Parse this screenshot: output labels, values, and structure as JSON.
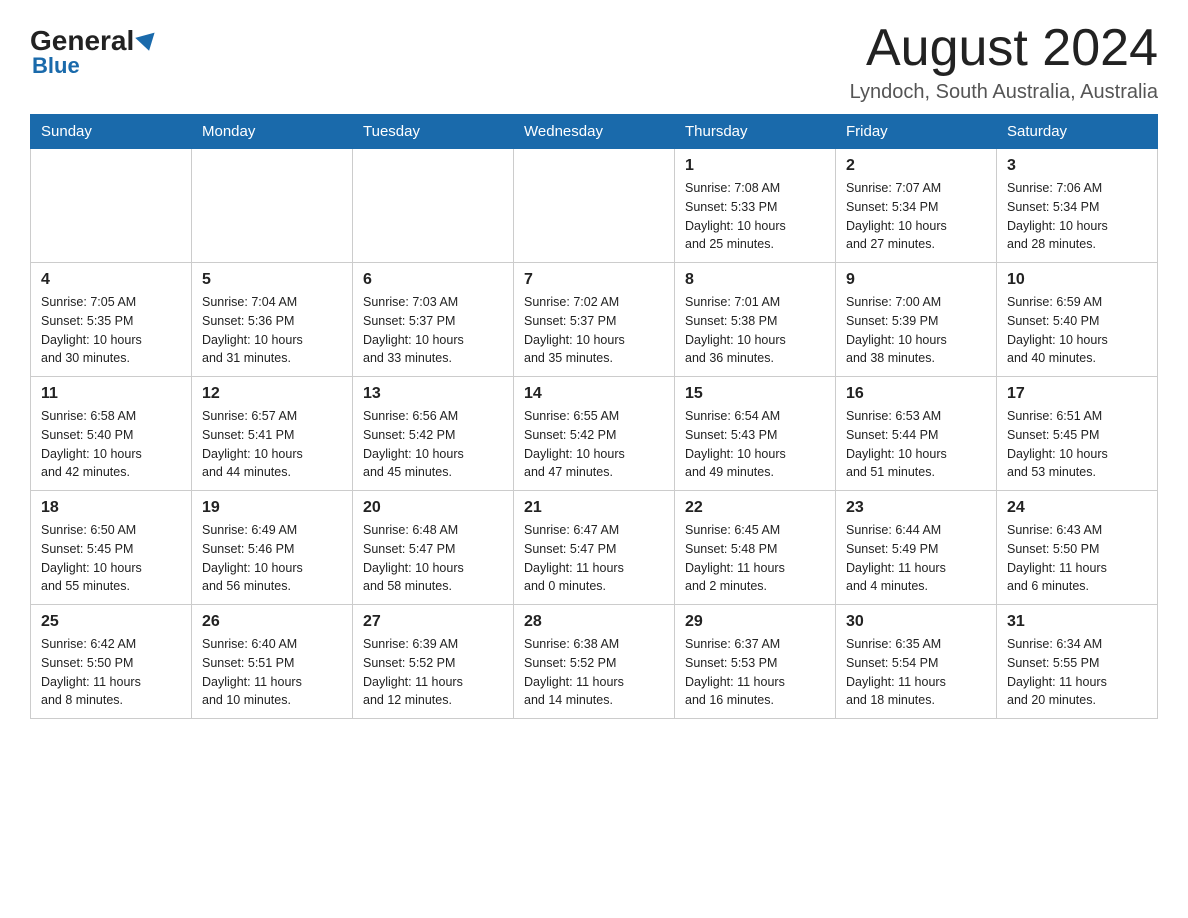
{
  "header": {
    "logo_general": "General",
    "logo_blue": "Blue",
    "month_title": "August 2024",
    "location": "Lyndoch, South Australia, Australia"
  },
  "weekdays": [
    "Sunday",
    "Monday",
    "Tuesday",
    "Wednesday",
    "Thursday",
    "Friday",
    "Saturday"
  ],
  "weeks": [
    {
      "days": [
        {
          "num": "",
          "info": ""
        },
        {
          "num": "",
          "info": ""
        },
        {
          "num": "",
          "info": ""
        },
        {
          "num": "",
          "info": ""
        },
        {
          "num": "1",
          "info": "Sunrise: 7:08 AM\nSunset: 5:33 PM\nDaylight: 10 hours\nand 25 minutes."
        },
        {
          "num": "2",
          "info": "Sunrise: 7:07 AM\nSunset: 5:34 PM\nDaylight: 10 hours\nand 27 minutes."
        },
        {
          "num": "3",
          "info": "Sunrise: 7:06 AM\nSunset: 5:34 PM\nDaylight: 10 hours\nand 28 minutes."
        }
      ]
    },
    {
      "days": [
        {
          "num": "4",
          "info": "Sunrise: 7:05 AM\nSunset: 5:35 PM\nDaylight: 10 hours\nand 30 minutes."
        },
        {
          "num": "5",
          "info": "Sunrise: 7:04 AM\nSunset: 5:36 PM\nDaylight: 10 hours\nand 31 minutes."
        },
        {
          "num": "6",
          "info": "Sunrise: 7:03 AM\nSunset: 5:37 PM\nDaylight: 10 hours\nand 33 minutes."
        },
        {
          "num": "7",
          "info": "Sunrise: 7:02 AM\nSunset: 5:37 PM\nDaylight: 10 hours\nand 35 minutes."
        },
        {
          "num": "8",
          "info": "Sunrise: 7:01 AM\nSunset: 5:38 PM\nDaylight: 10 hours\nand 36 minutes."
        },
        {
          "num": "9",
          "info": "Sunrise: 7:00 AM\nSunset: 5:39 PM\nDaylight: 10 hours\nand 38 minutes."
        },
        {
          "num": "10",
          "info": "Sunrise: 6:59 AM\nSunset: 5:40 PM\nDaylight: 10 hours\nand 40 minutes."
        }
      ]
    },
    {
      "days": [
        {
          "num": "11",
          "info": "Sunrise: 6:58 AM\nSunset: 5:40 PM\nDaylight: 10 hours\nand 42 minutes."
        },
        {
          "num": "12",
          "info": "Sunrise: 6:57 AM\nSunset: 5:41 PM\nDaylight: 10 hours\nand 44 minutes."
        },
        {
          "num": "13",
          "info": "Sunrise: 6:56 AM\nSunset: 5:42 PM\nDaylight: 10 hours\nand 45 minutes."
        },
        {
          "num": "14",
          "info": "Sunrise: 6:55 AM\nSunset: 5:42 PM\nDaylight: 10 hours\nand 47 minutes."
        },
        {
          "num": "15",
          "info": "Sunrise: 6:54 AM\nSunset: 5:43 PM\nDaylight: 10 hours\nand 49 minutes."
        },
        {
          "num": "16",
          "info": "Sunrise: 6:53 AM\nSunset: 5:44 PM\nDaylight: 10 hours\nand 51 minutes."
        },
        {
          "num": "17",
          "info": "Sunrise: 6:51 AM\nSunset: 5:45 PM\nDaylight: 10 hours\nand 53 minutes."
        }
      ]
    },
    {
      "days": [
        {
          "num": "18",
          "info": "Sunrise: 6:50 AM\nSunset: 5:45 PM\nDaylight: 10 hours\nand 55 minutes."
        },
        {
          "num": "19",
          "info": "Sunrise: 6:49 AM\nSunset: 5:46 PM\nDaylight: 10 hours\nand 56 minutes."
        },
        {
          "num": "20",
          "info": "Sunrise: 6:48 AM\nSunset: 5:47 PM\nDaylight: 10 hours\nand 58 minutes."
        },
        {
          "num": "21",
          "info": "Sunrise: 6:47 AM\nSunset: 5:47 PM\nDaylight: 11 hours\nand 0 minutes."
        },
        {
          "num": "22",
          "info": "Sunrise: 6:45 AM\nSunset: 5:48 PM\nDaylight: 11 hours\nand 2 minutes."
        },
        {
          "num": "23",
          "info": "Sunrise: 6:44 AM\nSunset: 5:49 PM\nDaylight: 11 hours\nand 4 minutes."
        },
        {
          "num": "24",
          "info": "Sunrise: 6:43 AM\nSunset: 5:50 PM\nDaylight: 11 hours\nand 6 minutes."
        }
      ]
    },
    {
      "days": [
        {
          "num": "25",
          "info": "Sunrise: 6:42 AM\nSunset: 5:50 PM\nDaylight: 11 hours\nand 8 minutes."
        },
        {
          "num": "26",
          "info": "Sunrise: 6:40 AM\nSunset: 5:51 PM\nDaylight: 11 hours\nand 10 minutes."
        },
        {
          "num": "27",
          "info": "Sunrise: 6:39 AM\nSunset: 5:52 PM\nDaylight: 11 hours\nand 12 minutes."
        },
        {
          "num": "28",
          "info": "Sunrise: 6:38 AM\nSunset: 5:52 PM\nDaylight: 11 hours\nand 14 minutes."
        },
        {
          "num": "29",
          "info": "Sunrise: 6:37 AM\nSunset: 5:53 PM\nDaylight: 11 hours\nand 16 minutes."
        },
        {
          "num": "30",
          "info": "Sunrise: 6:35 AM\nSunset: 5:54 PM\nDaylight: 11 hours\nand 18 minutes."
        },
        {
          "num": "31",
          "info": "Sunrise: 6:34 AM\nSunset: 5:55 PM\nDaylight: 11 hours\nand 20 minutes."
        }
      ]
    }
  ]
}
